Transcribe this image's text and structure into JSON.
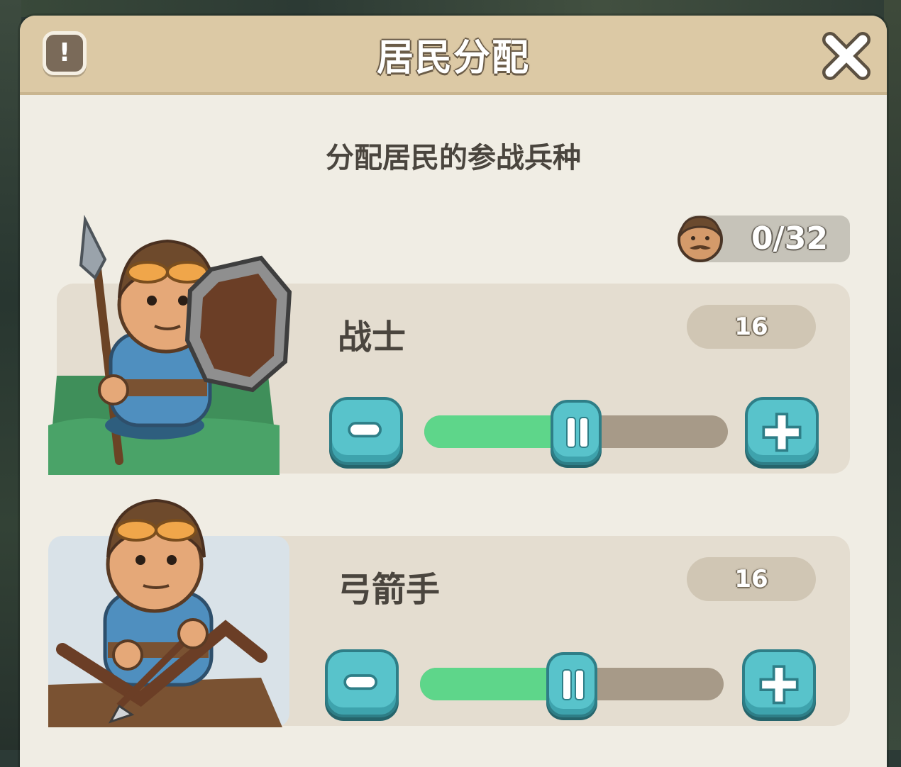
{
  "header": {
    "title": "居民分配",
    "warn_symbol": "!",
    "warn_icon": "exclamation-icon",
    "close_icon": "close-x-icon"
  },
  "subtitle": "分配居民的参战兵种",
  "population": {
    "value": "0/32",
    "icon": "citizen-face-icon"
  },
  "units": [
    {
      "name": "战士",
      "count": "16",
      "slider_fraction": 0.5,
      "portrait": "warrior-spear-shield-portrait"
    },
    {
      "name": "弓箭手",
      "count": "16",
      "slider_fraction": 0.5,
      "portrait": "archer-crossbow-portrait"
    }
  ],
  "colors": {
    "panel": "#f0ede4",
    "header": "#dcc9a5",
    "button_teal": "#58c3cb",
    "slider_fill": "#5ed68a",
    "slider_track": "#a79a88"
  }
}
